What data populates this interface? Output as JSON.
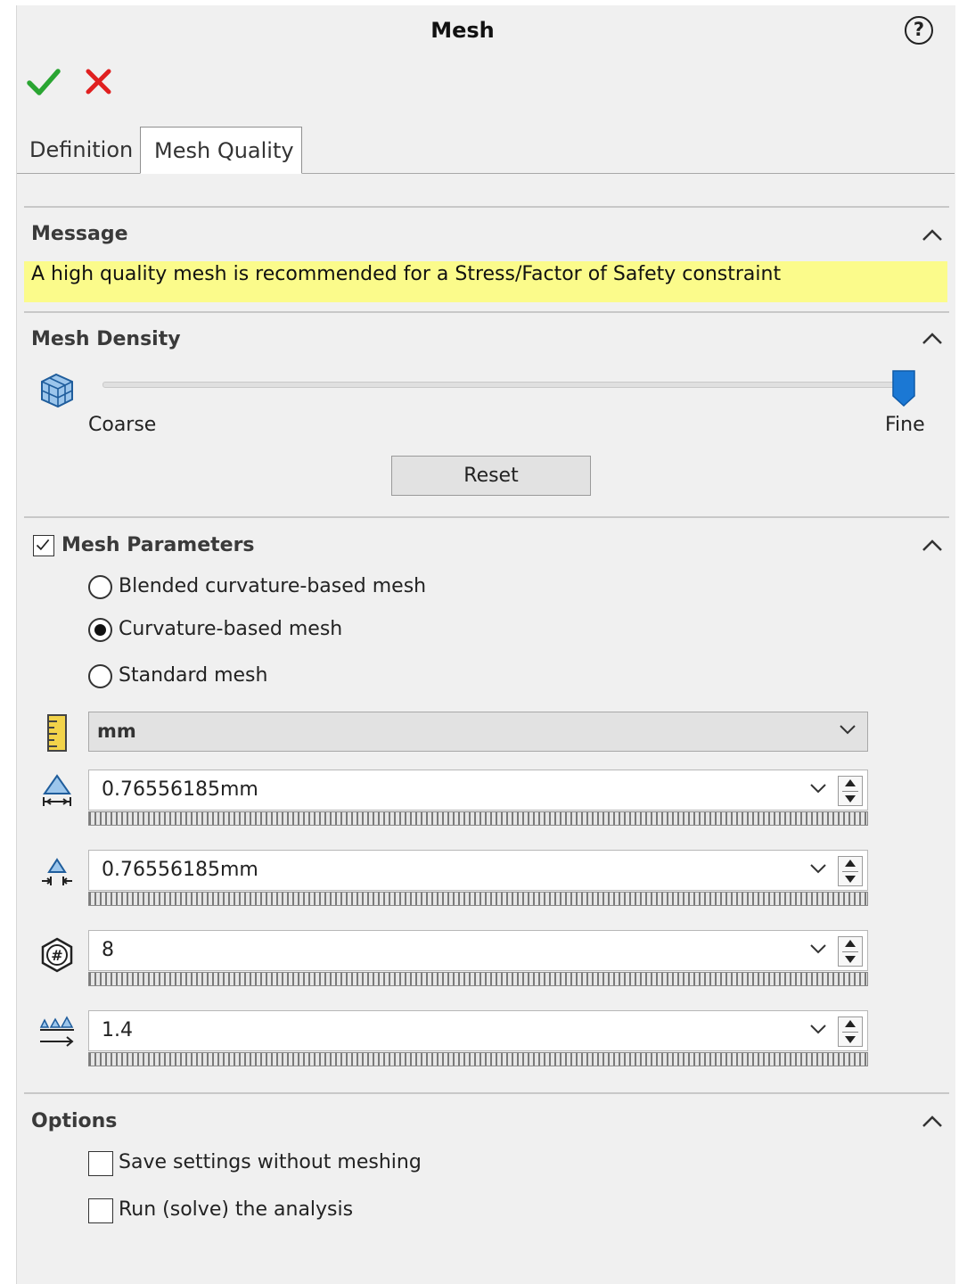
{
  "window": {
    "title": "Mesh"
  },
  "tabs": [
    {
      "label": "Definition",
      "active": false
    },
    {
      "label": "Mesh Quality",
      "active": true
    }
  ],
  "message": {
    "title": "Message",
    "text": "A high quality mesh is recommended for a Stress/Factor of Safety constraint",
    "banner_color": "#fbfb8b"
  },
  "mesh_density": {
    "title": "Mesh Density",
    "min_label": "Coarse",
    "max_label": "Fine",
    "level": 1.0,
    "reset_label": "Reset",
    "accent_color": "#1b78d4"
  },
  "mesh_parameters": {
    "title": "Mesh Parameters",
    "enabled": true,
    "options": [
      {
        "label": "Blended curvature-based mesh",
        "selected": false
      },
      {
        "label": "Curvature-based mesh",
        "selected": true
      },
      {
        "label": "Standard mesh",
        "selected": false
      }
    ],
    "unit": {
      "selected": "mm",
      "icon": "ruler-icon"
    },
    "fields": [
      {
        "value": "0.76556185mm",
        "icon": "max-element-size-icon"
      },
      {
        "value": "0.76556185mm",
        "icon": "min-element-size-icon"
      },
      {
        "value": "8",
        "icon": "elements-in-circle-icon"
      },
      {
        "value": "1.4",
        "icon": "element-growth-ratio-icon"
      }
    ]
  },
  "options": {
    "title": "Options",
    "items": [
      {
        "label": "Save settings without meshing",
        "checked": false
      },
      {
        "label": "Run (solve) the analysis",
        "checked": false
      }
    ]
  },
  "colors": {
    "ok": "#2aa532",
    "cancel": "#e02020",
    "panel": "#f0f0f0"
  }
}
